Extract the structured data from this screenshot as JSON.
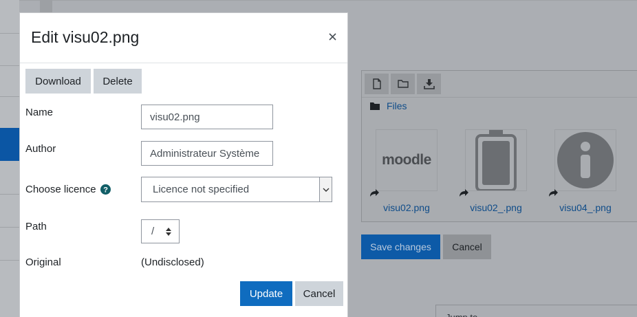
{
  "modal": {
    "title": "Edit visu02.png",
    "close_icon": "close-icon",
    "buttons": {
      "download": "Download",
      "delete": "Delete",
      "update": "Update",
      "cancel": "Cancel"
    },
    "fields": {
      "name": {
        "label": "Name",
        "value": "visu02.png"
      },
      "author": {
        "label": "Author",
        "value": "Administrateur Système"
      },
      "licence": {
        "label": "Choose licence",
        "selected": "Licence not specified",
        "help_icon": "question-circle-icon"
      },
      "path": {
        "label": "Path",
        "selected": "/"
      },
      "original": {
        "label": "Original",
        "value": "(Undisclosed)"
      }
    }
  },
  "filemanager": {
    "toolbar": [
      "file-add-icon",
      "folder-icon",
      "download-icon"
    ],
    "breadcrumb": "Files",
    "files": [
      {
        "name": "visu02.png",
        "thumb": "moodle"
      },
      {
        "name": "visu02_.png",
        "thumb": "battery"
      },
      {
        "name": "visu04_.png",
        "thumb": "info"
      }
    ],
    "thumb_text": {
      "moodle": "moodle"
    }
  },
  "form": {
    "save": "Save changes",
    "cancel": "Cancel",
    "jump": "Jump to..."
  },
  "colors": {
    "primary": "#0f6cbf",
    "secondary": "#ced4da",
    "link": "#0f6cbf",
    "help": "#115e67"
  }
}
